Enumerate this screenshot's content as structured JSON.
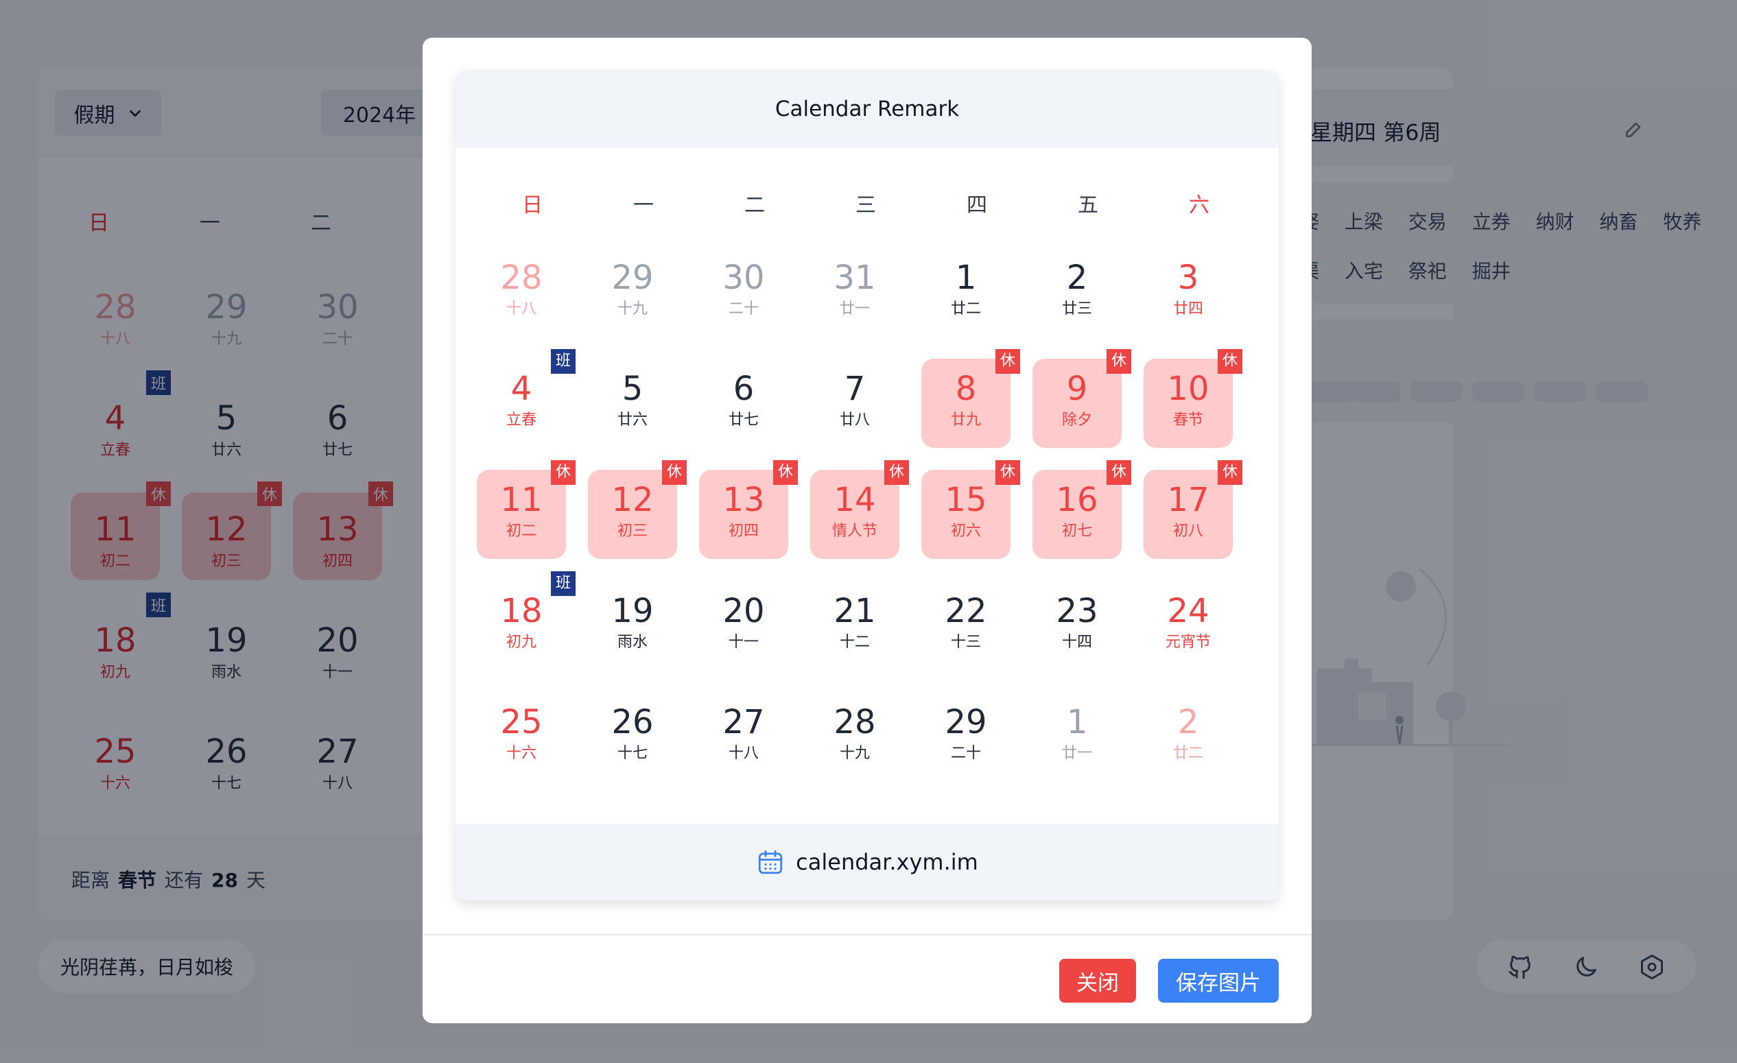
{
  "background": {
    "holiday_select": "假期",
    "year_select": "2024年",
    "weekdays": [
      "日",
      "一",
      "二"
    ],
    "cells": [
      {
        "n": "28",
        "l": "十八",
        "cls": "dimred"
      },
      {
        "n": "29",
        "l": "十九",
        "cls": "dim"
      },
      {
        "n": "30",
        "l": "二十",
        "cls": "dim"
      },
      {
        "n": "4",
        "l": "立春",
        "cls": "red",
        "badge": "班"
      },
      {
        "n": "5",
        "l": "廿六",
        "cls": ""
      },
      {
        "n": "6",
        "l": "廿七",
        "cls": ""
      },
      {
        "n": "11",
        "l": "初二",
        "cls": "hol",
        "badge": "休"
      },
      {
        "n": "12",
        "l": "初三",
        "cls": "hol",
        "badge": "休"
      },
      {
        "n": "13",
        "l": "初四",
        "cls": "hol",
        "badge": "休"
      },
      {
        "n": "18",
        "l": "初九",
        "cls": "red",
        "badge": "班"
      },
      {
        "n": "19",
        "l": "雨水",
        "cls": ""
      },
      {
        "n": "20",
        "l": "十一",
        "cls": ""
      },
      {
        "n": "25",
        "l": "十六",
        "cls": "red"
      },
      {
        "n": "26",
        "l": "十七",
        "cls": ""
      },
      {
        "n": "27",
        "l": "十八",
        "cls": ""
      }
    ],
    "countdown": {
      "prefix": "距离",
      "holiday": "春节",
      "middle": "还有",
      "days": "28",
      "suffix": "天"
    },
    "quote": "光阴荏苒，日月如梭",
    "date_header": "星期四 第6周",
    "yi_row1": "娶 上梁 交易 立券 纳财 纳畜 牧养",
    "yi_row2": "渠 入宅 祭祀 掘井"
  },
  "modal": {
    "title": "Calendar Remark",
    "weekdays": [
      "日",
      "一",
      "二",
      "三",
      "四",
      "五",
      "六"
    ],
    "days": [
      {
        "n": "28",
        "l": "十八",
        "cls": "dimred"
      },
      {
        "n": "29",
        "l": "十九",
        "cls": "dim"
      },
      {
        "n": "30",
        "l": "二十",
        "cls": "dim"
      },
      {
        "n": "31",
        "l": "廿一",
        "cls": "dim"
      },
      {
        "n": "1",
        "l": "廿二",
        "cls": ""
      },
      {
        "n": "2",
        "l": "廿三",
        "cls": ""
      },
      {
        "n": "3",
        "l": "廿四",
        "cls": "red"
      },
      {
        "n": "4",
        "l": "立春",
        "cls": "red",
        "badge": "班"
      },
      {
        "n": "5",
        "l": "廿六",
        "cls": ""
      },
      {
        "n": "6",
        "l": "廿七",
        "cls": ""
      },
      {
        "n": "7",
        "l": "廿八",
        "cls": ""
      },
      {
        "n": "8",
        "l": "廿九",
        "cls": "hol",
        "badge": "休"
      },
      {
        "n": "9",
        "l": "除夕",
        "cls": "hol",
        "badge": "休"
      },
      {
        "n": "10",
        "l": "春节",
        "cls": "hol",
        "badge": "休"
      },
      {
        "n": "11",
        "l": "初二",
        "cls": "hol",
        "badge": "休"
      },
      {
        "n": "12",
        "l": "初三",
        "cls": "hol",
        "badge": "休"
      },
      {
        "n": "13",
        "l": "初四",
        "cls": "hol",
        "badge": "休"
      },
      {
        "n": "14",
        "l": "情人节",
        "cls": "hol",
        "badge": "休"
      },
      {
        "n": "15",
        "l": "初六",
        "cls": "hol",
        "badge": "休"
      },
      {
        "n": "16",
        "l": "初七",
        "cls": "hol",
        "badge": "休"
      },
      {
        "n": "17",
        "l": "初八",
        "cls": "hol",
        "badge": "休"
      },
      {
        "n": "18",
        "l": "初九",
        "cls": "red",
        "badge": "班"
      },
      {
        "n": "19",
        "l": "雨水",
        "cls": ""
      },
      {
        "n": "20",
        "l": "十一",
        "cls": ""
      },
      {
        "n": "21",
        "l": "十二",
        "cls": ""
      },
      {
        "n": "22",
        "l": "十三",
        "cls": ""
      },
      {
        "n": "23",
        "l": "十四",
        "cls": ""
      },
      {
        "n": "24",
        "l": "元宵节",
        "cls": "red"
      },
      {
        "n": "25",
        "l": "十六",
        "cls": "red"
      },
      {
        "n": "26",
        "l": "十七",
        "cls": ""
      },
      {
        "n": "27",
        "l": "十八",
        "cls": ""
      },
      {
        "n": "28",
        "l": "十九",
        "cls": ""
      },
      {
        "n": "29",
        "l": "二十",
        "cls": ""
      },
      {
        "n": "1",
        "l": "廿一",
        "cls": "dim"
      },
      {
        "n": "2",
        "l": "廿二",
        "cls": "dimred"
      }
    ],
    "footer_text": "calendar.xym.im",
    "footer_icon": "calendar-icon",
    "close_label": "关闭",
    "save_label": "保存图片"
  },
  "colors": {
    "holiday_bg": "#fecaca",
    "holiday_text": "#ef4444",
    "rest_badge": "#ef4444",
    "work_badge": "#1e3a8a",
    "save_button": "#3b82f6",
    "close_button": "#ef4444"
  }
}
